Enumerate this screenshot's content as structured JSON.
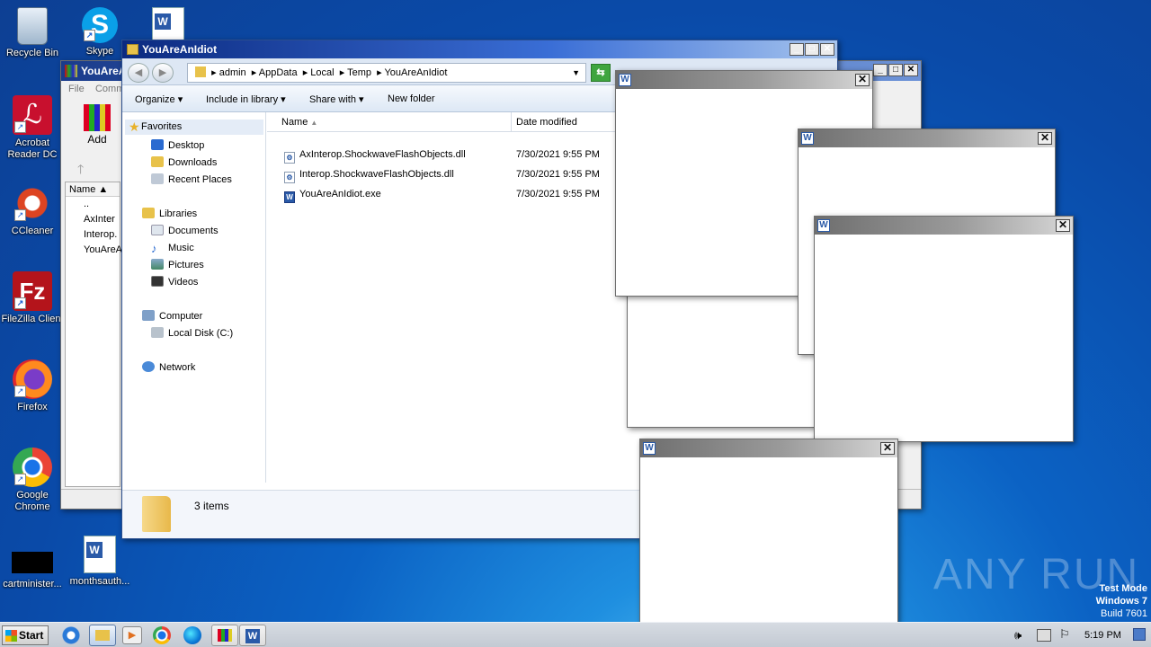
{
  "desktop": {
    "icons": [
      {
        "label": "Recycle Bin",
        "icon": "recycle-bin-icon"
      },
      {
        "label": "Skype",
        "icon": "skype-icon"
      },
      {
        "label": "",
        "icon": "word-doc-icon"
      },
      {
        "label": "Acrobat Reader DC",
        "icon": "acrobat-icon"
      },
      {
        "label": "CCleaner",
        "icon": "ccleaner-icon"
      },
      {
        "label": "FileZilla Client",
        "icon": "filezilla-icon"
      },
      {
        "label": "Firefox",
        "icon": "firefox-icon"
      },
      {
        "label": "Google Chrome",
        "icon": "chrome-icon"
      },
      {
        "label": "cartminister...",
        "icon": "black-file-icon"
      },
      {
        "label": "monthsauth...",
        "icon": "word-doc-icon"
      }
    ],
    "watermark": "ANY RUN",
    "os_info": [
      "Test Mode",
      "Windows 7",
      "Build 7601"
    ]
  },
  "winrar": {
    "title": "YouAreA",
    "menu": [
      "File",
      "Comm"
    ],
    "add_label": "Add",
    "col_name": "Name",
    "rows": [
      "..",
      "AxInter",
      "Interop.",
      "YouAreA"
    ]
  },
  "explorer": {
    "title": "YouAreAnIdiot",
    "breadcrumb": [
      "admin",
      "AppData",
      "Local",
      "Temp",
      "YouAreAnIdiot"
    ],
    "toolbar": {
      "organize": "Organize",
      "include": "Include in library",
      "share": "Share with",
      "new_folder": "New folder"
    },
    "nav": {
      "favorites": "Favorites",
      "desktop": "Desktop",
      "downloads": "Downloads",
      "recent": "Recent Places",
      "libraries": "Libraries",
      "documents": "Documents",
      "music": "Music",
      "pictures": "Pictures",
      "videos": "Videos",
      "computer": "Computer",
      "local_disk": "Local Disk (C:)",
      "network": "Network"
    },
    "columns": {
      "name": "Name",
      "date": "Date modified"
    },
    "files": [
      {
        "name": "AxInterop.ShockwaveFlashObjects.dll",
        "date": "7/30/2021 9:55 PM"
      },
      {
        "name": "Interop.ShockwaveFlashObjects.dll",
        "date": "7/30/2021 9:55 PM"
      },
      {
        "name": "YouAreAnIdiot.exe",
        "date": "7/30/2021 9:55 PM"
      }
    ],
    "status": "3 items"
  },
  "taskbar": {
    "start": "Start",
    "clock": "5:19 PM"
  }
}
